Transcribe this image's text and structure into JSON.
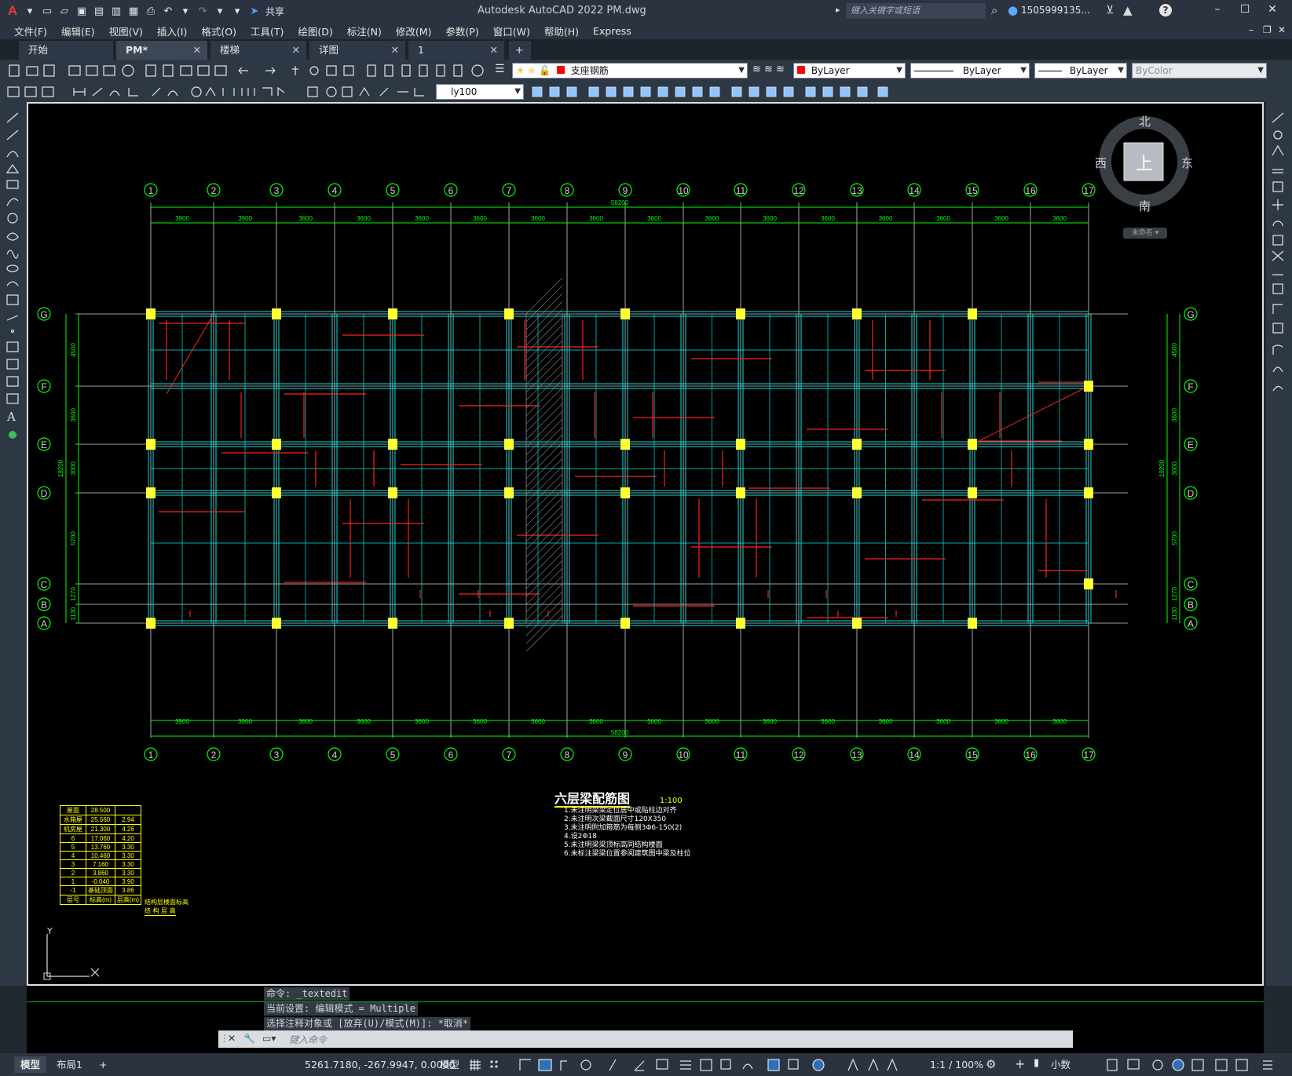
{
  "app": {
    "logo": "A",
    "title": "Autodesk AutoCAD 2022    PM.dwg",
    "search_placeholder": "键入关键字或短语",
    "user": "1505999135...",
    "share_label": "共享"
  },
  "menu": [
    "文件(F)",
    "编辑(E)",
    "视图(V)",
    "插入(I)",
    "格式(O)",
    "工具(T)",
    "绘图(D)",
    "标注(N)",
    "修改(M)",
    "参数(P)",
    "窗口(W)",
    "帮助(H)",
    "Express"
  ],
  "tabs": [
    {
      "label": "开始",
      "active": false,
      "closable": false
    },
    {
      "label": "PM*",
      "active": true,
      "closable": true
    },
    {
      "label": "楼梯",
      "active": false,
      "closable": true
    },
    {
      "label": "详图",
      "active": false,
      "closable": true
    },
    {
      "label": "1",
      "active": false,
      "closable": true
    }
  ],
  "toolbar": {
    "layer": "支座钢筋",
    "color": "ByLayer",
    "linetype": "ByLayer",
    "lineweight": "ByLayer",
    "plotstyle": "ByColor",
    "dimstyle": "ly100"
  },
  "viewcube": {
    "north": "北",
    "south": "南",
    "east": "东",
    "west": "西",
    "top": "上",
    "wcs": "未命名"
  },
  "drawing": {
    "grid_numbers": [
      "1",
      "2",
      "3",
      "4",
      "5",
      "6",
      "7",
      "8",
      "9",
      "10",
      "11",
      "12",
      "13",
      "14",
      "15",
      "16",
      "17"
    ],
    "grid_letters": [
      "G",
      "F",
      "E",
      "D",
      "C",
      "B",
      "A"
    ],
    "top_spacings": [
      "3900",
      "3900",
      "3600",
      "3600",
      "3600",
      "3600",
      "3600",
      "3600",
      "3600",
      "3600",
      "3600",
      "3600",
      "3600",
      "3600",
      "3600",
      "3600"
    ],
    "total_length": "58200",
    "left_dims": [
      "4500",
      "3600",
      "3000",
      "5700",
      "1270",
      "1130"
    ],
    "total_width": "19200",
    "plan_title": "六层梁配筋图",
    "plan_scale": "1:100",
    "notes": [
      "1.未注明梁梁定位居中或贴柱边对齐",
      "2.未注明次梁截面尺寸120X350",
      "3.未注明附加箍筋为每侧3Φ6-150(2)",
      "4.设2Φ18",
      "5.未注明梁梁顶标高同结构楼面",
      "6.未标注梁梁位置参阅建筑图中梁及柱位"
    ],
    "floor_table": {
      "rows": [
        [
          "屋面",
          "28.500",
          ""
        ],
        [
          "水箱屋",
          "25.560",
          "2.94"
        ],
        [
          "机房屋",
          "21.300",
          "4.26"
        ],
        [
          "6",
          "17.060",
          "4.20"
        ],
        [
          "5",
          "13.760",
          "3.30"
        ],
        [
          "4",
          "10.460",
          "3.30"
        ],
        [
          "3",
          "7.160",
          "3.30"
        ],
        [
          "2",
          "3.860",
          "3.30"
        ],
        [
          "1",
          "-0.040",
          "3.90"
        ],
        [
          "-1",
          "基础顶面",
          "3.86"
        ]
      ],
      "footer": [
        "层号",
        "标高(m)",
        "层高(m)"
      ],
      "side_label": "结构层楼面标高",
      "side_label2": "结 构 层 高"
    },
    "ucs_y": "Y"
  },
  "command": {
    "history": [
      "命令: _textedit",
      "当前设置: 编辑模式 = Multiple",
      "选择注释对象或 [放弃(U)/模式(M)]: *取消*"
    ],
    "placeholder": "键入命令"
  },
  "status": {
    "layout_tabs": [
      "模型",
      "布局1"
    ],
    "coords": "5261.7180, -267.9947, 0.0000",
    "mode": "模型",
    "scale": "1:1 / 100%",
    "units": "小数"
  },
  "colors": {
    "grid_green": "#00ff00",
    "beam_cyan": "#00e5e5",
    "rebar_red": "#ff2020",
    "label_yellow": "#ffff00",
    "column_yellow": "#ffff33",
    "axis_white": "#d0d0d0"
  }
}
